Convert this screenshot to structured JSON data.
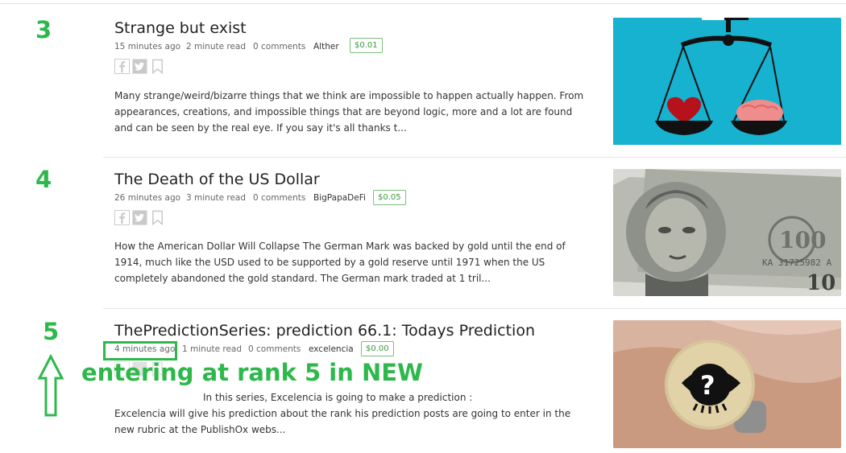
{
  "posts": [
    {
      "rank": "3",
      "title": "Strange but exist",
      "time": "15 minutes ago",
      "read": "2 minute read",
      "comments": "0 comments",
      "author": "Alther",
      "tip": "$0.01",
      "excerpt": "Many strange/weird/bizarre things that we think are impossible to happen actually happen. From appearances, creations, and impossible things that are beyond logic, more and a lot are found and can be seen by the real eye. If you say it's all thanks t..."
    },
    {
      "rank": "4",
      "title": "The Death of the US Dollar",
      "time": "26 minutes ago",
      "read": "3 minute read",
      "comments": "0 comments",
      "author": "BigPapaDeFi",
      "tip": "$0.05",
      "excerpt": "How the American Dollar Will Collapse The German Mark was backed by gold until the end of 1914, much like the USD used to be supported by a gold reserve until 1971 when the US completely abandoned the gold standard. The German mark traded at 1 tril..."
    },
    {
      "rank": "5",
      "title": "ThePredictionSeries: prediction 66.1: Todays Prediction",
      "time": "4 minutes ago",
      "read": "1 minute read",
      "comments": "0 comments",
      "author": "excelencia",
      "tip": "$0.00",
      "excerpt_line1": "In this  series, Excelencia is going  to make a  prediction :",
      "excerpt_rest": "Excelencia will give his prediction about the rank his  prediction posts are going to enter in the new rubric at the PublishOx webs..."
    }
  ],
  "annotation": {
    "text": "entering at rank 5 in NEW",
    "color": "#2eb84b"
  },
  "icons": [
    "facebook-icon",
    "twitter-icon",
    "bookmark-icon",
    "up-arrow-icon"
  ],
  "colors": {
    "accent_green": "#2eb84b",
    "tip_border": "#7bbf7b",
    "title": "#222222"
  }
}
